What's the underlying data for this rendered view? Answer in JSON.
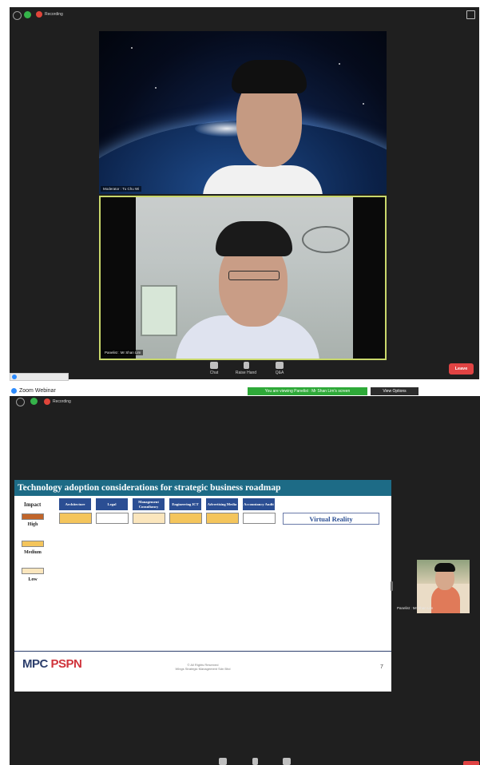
{
  "top_window": {
    "recording_label": "Recording",
    "speaker_tag": "Moderator : Tu Chu Wi",
    "active_tag": "Panelist : Mr Shan Lim",
    "toolbar": {
      "chat": "Chat",
      "raise_hand": "Raise Hand",
      "qa": "Q&A"
    },
    "leave_label": "Leave"
  },
  "webinar": {
    "app_title": "Zoom Webinar",
    "viewing_banner": "You are viewing Panelist : Mr Shan Lim's screen",
    "view_options": "View Options",
    "recording_label": "Recording",
    "thumbnail_tag": "Panelist : Mr Shan Lim",
    "slide": {
      "title": "Technology adoption considerations for strategic business roadmap",
      "impact_label": "Impact",
      "legend": [
        {
          "label": "High",
          "color": "#c1652a"
        },
        {
          "label": "Medium",
          "color": "#f4c55c"
        },
        {
          "label": "Low",
          "color": "#fbe6bd"
        }
      ],
      "columns": [
        {
          "label": "Architecture",
          "color": "#f4c55c"
        },
        {
          "label": "Legal",
          "color": "#ffffff"
        },
        {
          "label": "Management Consultancy",
          "color": "#fbe6bd"
        },
        {
          "label": "Engineering ICT",
          "color": "#f4c55c"
        },
        {
          "label": "Advertising Media",
          "color": "#f4c55c"
        },
        {
          "label": "Accountancy Audit",
          "color": "#ffffff"
        }
      ],
      "technology": "Virtual Reality",
      "logo_left": "MPC",
      "logo_right": "PSPN",
      "copyright_1": "© All Rights Reserved",
      "copyright_2": "Wings Strategic Management Sdn Bhd",
      "page_number": "7"
    }
  },
  "colors": {
    "zoom_dark": "#1f1f1f",
    "slide_header": "#1d6b86",
    "column_header": "#2b4e93",
    "leave_red": "#e04343",
    "viewing_green": "#2ea938",
    "active_speaker_border": "#c9d86b"
  }
}
